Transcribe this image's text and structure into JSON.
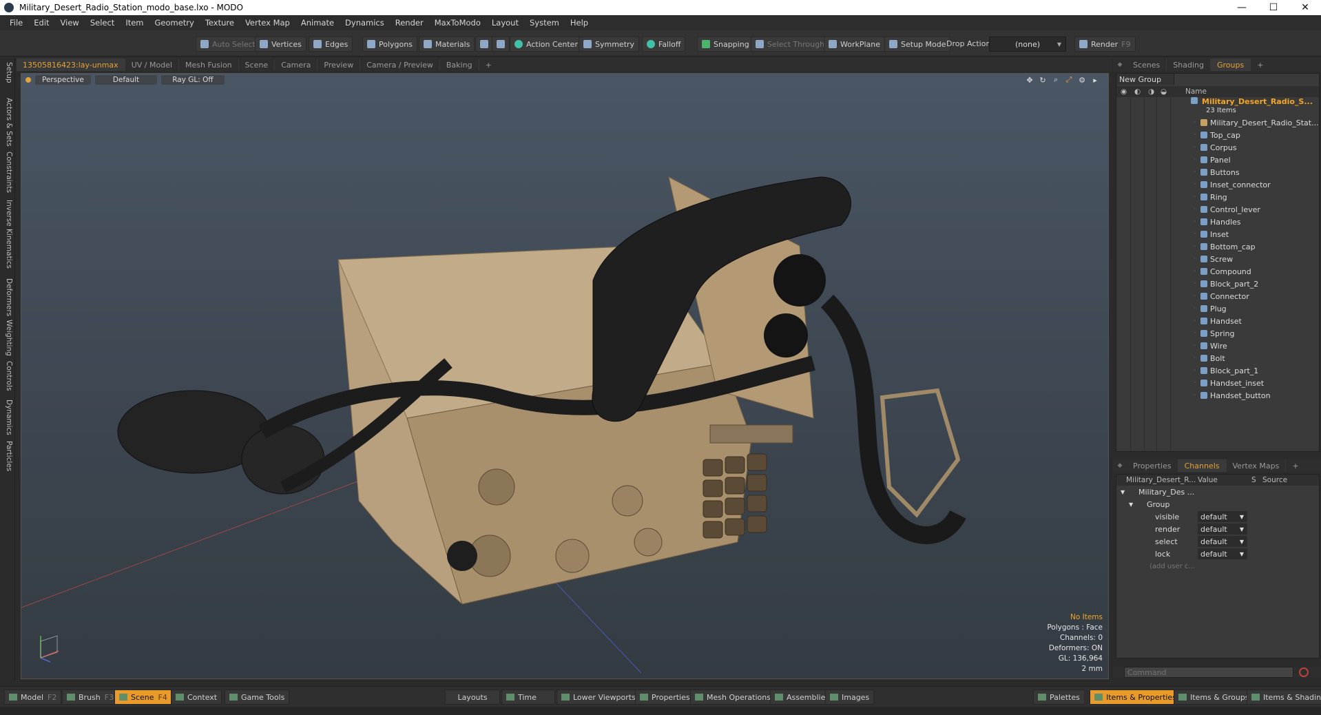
{
  "window": {
    "title": "Military_Desert_Radio_Station_modo_base.lxo - MODO",
    "minimize": "—",
    "maximize": "☐",
    "close": "✕"
  },
  "menu": [
    "File",
    "Edit",
    "View",
    "Select",
    "Item",
    "Geometry",
    "Texture",
    "Vertex Map",
    "Animate",
    "Dynamics",
    "Render",
    "MaxToModo",
    "Layout",
    "System",
    "Help"
  ],
  "toolbar": {
    "auto_select": "Auto Select",
    "vertices": "Vertices",
    "edges": "Edges",
    "polygons": "Polygons",
    "materials": "Materials",
    "action_center": "Action Center",
    "symmetry": "Symmetry",
    "falloff": "Falloff",
    "snapping": "Snapping",
    "select_through": "Select Through",
    "workplane": "WorkPlane",
    "setup_mode": "Setup Mode",
    "drop_action": "Drop Action",
    "drop_value": "(none)",
    "render": "Render",
    "render_key": "F9"
  },
  "left_tabs": [
    "Setup",
    "Actors & Sets",
    "Constraints",
    "Inverse Kinematics",
    "Deformers",
    "Weighting",
    "Controls",
    "Dynamics",
    "Particles"
  ],
  "viewport_tabs": [
    "13505816423:lay-unmax",
    "UV / Model",
    "Mesh Fusion",
    "Scene",
    "Camera",
    "Preview",
    "Camera / Preview",
    "Baking",
    "+"
  ],
  "viewport": {
    "view": "Perspective",
    "style": "Default",
    "raygl": "Ray GL: Off",
    "info": {
      "items": "No Items",
      "polygons": "Polygons : Face",
      "channels": "Channels: 0",
      "deformers": "Deformers: ON",
      "gl": "GL: 136,964",
      "scale": "2 mm"
    }
  },
  "right_tabs": [
    "Scenes",
    "Shading",
    "Groups",
    "+"
  ],
  "groups": {
    "new_group": "New Group",
    "col_name": "Name",
    "root_name": "Military_Desert_Radio_S...",
    "root_count": "23 Items",
    "items": [
      "Military_Desert_Radio_Stat...",
      "Top_cap",
      "Corpus",
      "Panel",
      "Buttons",
      "Inset_connector",
      "Ring",
      "Control_lever",
      "Handles",
      "Inset",
      "Bottom_cap",
      "Screw",
      "Compound",
      "Block_part_2",
      "Connector",
      "Plug",
      "Handset",
      "Spring",
      "Wire",
      "Bolt",
      "Block_part_1",
      "Handset_inset",
      "Handset_button"
    ]
  },
  "prop_tabs": [
    "Properties",
    "Channels",
    "Vertex Maps",
    "+"
  ],
  "channels": {
    "col_name": "Military_Desert_R...",
    "col_value": "Value",
    "col_s": "S",
    "col_source": "Source",
    "root": "Military_Des ...",
    "group": "Group",
    "rows": [
      {
        "name": "visible",
        "value": "default"
      },
      {
        "name": "render",
        "value": "default"
      },
      {
        "name": "select",
        "value": "default"
      },
      {
        "name": "lock",
        "value": "default"
      }
    ],
    "add_user": "(add user c..."
  },
  "command": {
    "placeholder": "Command"
  },
  "bottom": {
    "model": "Model",
    "model_key": "F2",
    "brush": "Brush",
    "brush_key": "F3",
    "scene": "Scene",
    "scene_key": "F4",
    "context": "Context",
    "game_tools": "Game Tools",
    "layouts": "Layouts",
    "time": "Time",
    "lower_viewports": "Lower Viewports",
    "properties": "Properties",
    "mesh_operations": "Mesh Operations",
    "assemblies": "Assemblies",
    "images": "Images",
    "palettes": "Palettes",
    "items_properties": "Items & Properties",
    "items_groups": "Items & Groups",
    "items_shading": "Items & Shading"
  },
  "colors": {
    "accent": "#f5a623",
    "viewport_top": "#4a5664",
    "viewport_bottom": "#343b42"
  }
}
